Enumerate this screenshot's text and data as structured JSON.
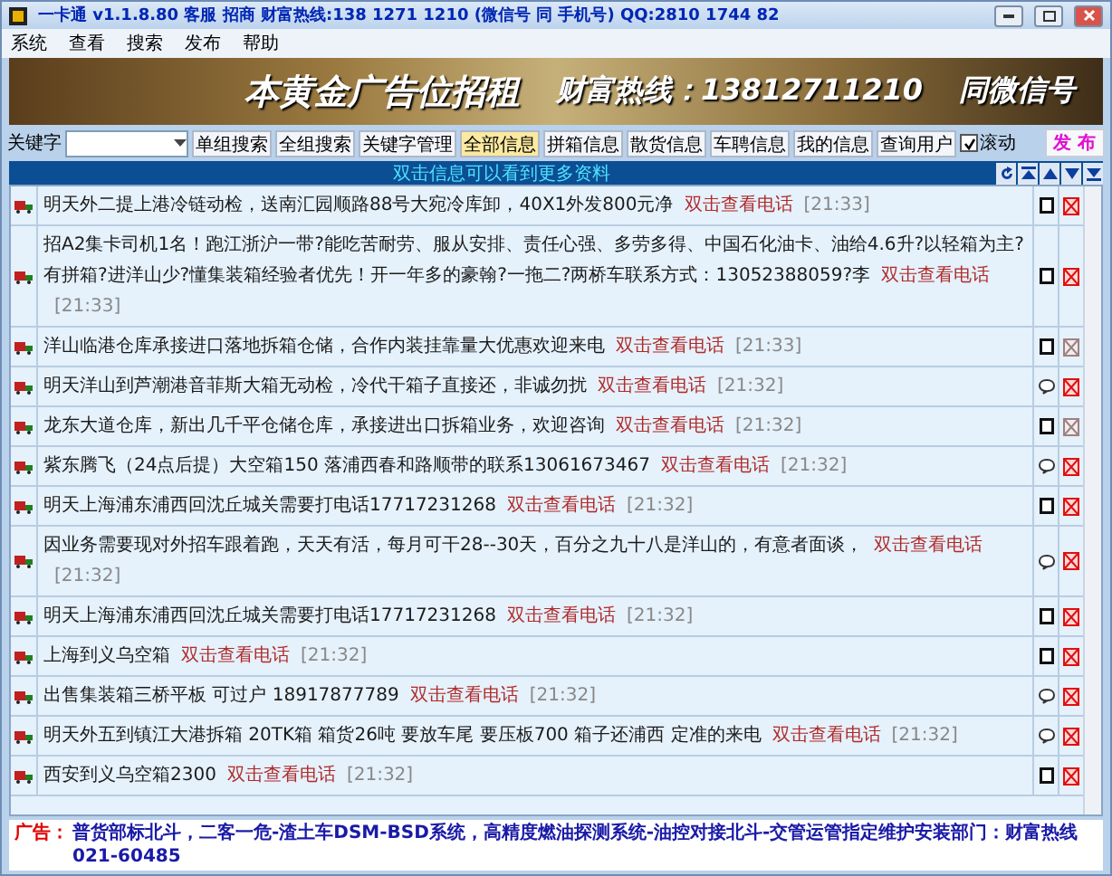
{
  "window": {
    "title": "一卡通 v1.1.8.80  客服 招商 财富热线:138 1271 1210 (微信号 同 手机号)  QQ:2810 1744 82"
  },
  "menu": [
    "系统",
    "查看",
    "搜索",
    "发布",
    "帮助"
  ],
  "banner": {
    "texts": [
      "本黄金广告位招租",
      "财富热线：13812711210",
      "同微信号"
    ]
  },
  "toolbar": {
    "keyword_label": "关键字",
    "search_buttons": [
      "单组搜索",
      "全组搜索",
      "关键字管理"
    ],
    "filters": [
      {
        "label": "全部信息",
        "selected": true
      },
      {
        "label": "拼箱信息",
        "selected": false
      },
      {
        "label": "散货信息",
        "selected": false
      },
      {
        "label": "车聘信息",
        "selected": false
      },
      {
        "label": "我的信息",
        "selected": false
      },
      {
        "label": "查询用户",
        "selected": false
      }
    ],
    "scroll_checkbox": {
      "label": "滚动",
      "checked": true
    },
    "publish_button": "发 布"
  },
  "hint_bar": {
    "text": "双击信息可以看到更多资料"
  },
  "messages": [
    {
      "text": "明天外二提上港冷链动检，送南汇园顺路88号大宛冷库卸，40X1外发800元净",
      "link": "双击查看电话",
      "time": "[21:33]",
      "kind": "square",
      "flagged": true
    },
    {
      "text": "招A2集卡司机1名！跑江浙沪一带?能吃苦耐劳、服从安排、责任心强、多劳多得、中国石化油卡、油给4.6升?以轻箱为主?有拼箱?进洋山少?懂集装箱经验者优先！开一年多的豪翰?一拖二?两桥车联系方式：13052388059?李",
      "link": "双击查看电话",
      "time": "[21:33]",
      "kind": "square",
      "flagged": true
    },
    {
      "text": "洋山临港仓库承接进口落地拆箱仓储，合作内装挂靠量大优惠欢迎来电",
      "link": "双击查看电话",
      "time": "[21:33]",
      "kind": "square",
      "flagged": false
    },
    {
      "text": "明天洋山到芦潮港音菲斯大箱无动检，冷代干箱子直接还，非诚勿扰",
      "link": "双击查看电话",
      "time": "[21:32]",
      "kind": "bubble",
      "flagged": true
    },
    {
      "text": "龙东大道仓库，新出几千平仓储仓库，承接进出口拆箱业务，欢迎咨询",
      "link": "双击查看电话",
      "time": "[21:32]",
      "kind": "square",
      "flagged": false
    },
    {
      "text": "紫东腾飞（24点后提）大空箱150 落浦西春和路顺带的联系13061673467",
      "link": "双击查看电话",
      "time": "[21:32]",
      "kind": "bubble",
      "flagged": true
    },
    {
      "text": "明天上海浦东浦西回沈丘城关需要打电话17717231268",
      "link": "双击查看电话",
      "time": "[21:32]",
      "kind": "square",
      "flagged": true
    },
    {
      "text": "因业务需要现对外招车跟着跑，天天有活，每月可干28--30天，百分之九十八是洋山的，有意者面谈，",
      "link": "双击查看电话",
      "time": "[21:32]",
      "kind": "bubble",
      "flagged": true
    },
    {
      "text": "明天上海浦东浦西回沈丘城关需要打电话17717231268",
      "link": "双击查看电话",
      "time": "[21:32]",
      "kind": "square",
      "flagged": true
    },
    {
      "text": "上海到义乌空箱",
      "link": "双击查看电话",
      "time": "[21:32]",
      "kind": "square",
      "flagged": true
    },
    {
      "text": "出售集装箱三桥平板 可过户 18917877789",
      "link": "双击查看电话",
      "time": "[21:32]",
      "kind": "bubble",
      "flagged": true
    },
    {
      "text": "明天外五到镇江大港拆箱 20TK箱 箱货26吨 要放车尾 要压板700  箱子还浦西 定准的来电",
      "link": "双击查看电话",
      "time": "[21:32]",
      "kind": "bubble",
      "flagged": true
    },
    {
      "text": "西安到义乌空箱2300",
      "link": "双击查看电话",
      "time": "[21:32]",
      "kind": "square",
      "flagged": true
    }
  ],
  "ad_bar": {
    "label": "广告：",
    "text": "普货部标北斗，二客一危-渣土车DSM-BSD系统，高精度燃油探测系统-油控对接北斗-交管运管指定维护安装部门：财富热线021-60485"
  }
}
